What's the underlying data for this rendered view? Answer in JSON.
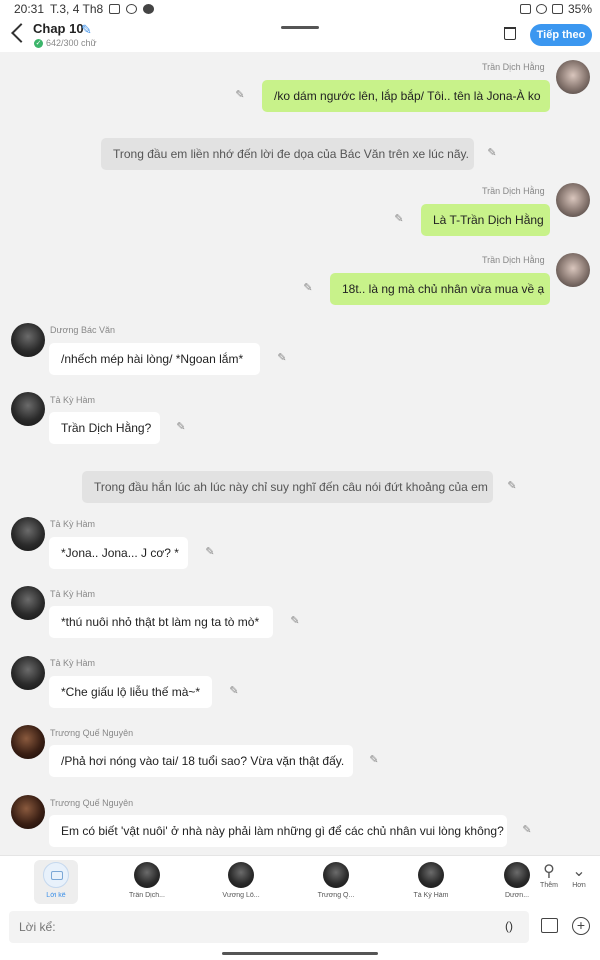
{
  "status_bar": {
    "time": "20:31",
    "date": "T.3, 4 Th8",
    "battery": "35%"
  },
  "header": {
    "title": "Chap 10",
    "char_count": "642/300 chữ",
    "follow_label": "Tiếp theo"
  },
  "messages": [
    {
      "type": "right",
      "name": "Trần Dịch Hằng",
      "text": "/ko dám ngước lên, lắp bắp/ Tôi.. tên là Jona-À ko"
    },
    {
      "type": "narr",
      "text": "Trong đầu em liền nhớ đến lời đe dọa của Bác Văn trên xe lúc nãy."
    },
    {
      "type": "right",
      "name": "Trần Dịch Hằng",
      "text": "Là T-Trần Dịch Hằng"
    },
    {
      "type": "right",
      "name": "Trần Dịch Hằng",
      "text": "18t.. là ng mà chủ nhân vừa mua về ạ"
    },
    {
      "type": "left",
      "name": "Dương Bác Văn",
      "text": "/nhếch mép hài lòng/  *Ngoan lắm*"
    },
    {
      "type": "left",
      "name": "Tả Kỳ Hàm",
      "text": "Trần Dịch Hằng?"
    },
    {
      "type": "narr",
      "text": "Trong đầu hắn lúc ah lúc này chỉ suy nghĩ đến câu nói đứt khoảng của em"
    },
    {
      "type": "left",
      "name": "Tả Kỳ Hàm",
      "text": "*Jona.. Jona... J cơ? *"
    },
    {
      "type": "left",
      "name": "Tả Kỳ Hàm",
      "text": "*thú nuôi nhỏ thật bt làm ng ta tò mò*"
    },
    {
      "type": "left",
      "name": "Tả Kỳ Hàm",
      "text": "*Che giấu lộ liễu thế mà~*"
    },
    {
      "type": "left",
      "name": "Trương Quế Nguyên",
      "text": "/Phả hơi nóng vào tai/ 18 tuổi sao? Vừa vặn thật đấy."
    },
    {
      "type": "left",
      "name": "Trương Quế Nguyên",
      "text": "Em có biết 'vật nuôi' ở nhà này phải làm những gì để các chủ nhân vui lòng không?"
    }
  ],
  "characters": [
    {
      "label": "Lời kể"
    },
    {
      "label": "Trần Dịch..."
    },
    {
      "label": "Vương Lỗ..."
    },
    {
      "label": "Trương Q..."
    },
    {
      "label": "Tả Kỳ Hàm"
    },
    {
      "label": "Dươn..."
    }
  ],
  "tools": {
    "add_label": "Thêm",
    "more_label": "Hơn"
  },
  "input": {
    "placeholder": "Lời kể:",
    "paren": "()"
  },
  "icons": [
    "back-icon",
    "pencil-icon",
    "check-icon",
    "trash-icon",
    "add-person-icon",
    "chevron-down-icon",
    "image-icon",
    "plus-icon"
  ],
  "colors": {
    "accent": "#3b97f0",
    "own_bubble": "#c8f28a",
    "narration_bubble": "#e2e2e2",
    "chat_background": "#f2f2f2"
  }
}
